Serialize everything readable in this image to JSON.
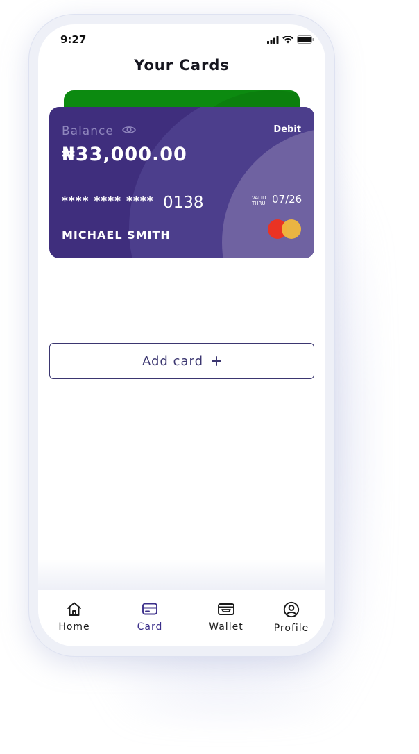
{
  "status_bar": {
    "time": "9:27"
  },
  "header": {
    "title": "Your Cards"
  },
  "cards": {
    "back_card_color": "#0c8a10",
    "primary": {
      "balance_label": "Balance",
      "type": "Debit",
      "balance": "₦33,000.00",
      "number_masked": "**** **** ****",
      "number_last4": "0138",
      "valid_thru_label": "VALID THRU",
      "expiry": "07/26",
      "holder": "MICHAEL SMITH",
      "network_icon": "mastercard-logo",
      "color": "#3f2e7d"
    }
  },
  "actions": {
    "add_card_label": "Add card",
    "add_card_icon": "plus-icon"
  },
  "bottom_nav": {
    "items": [
      {
        "label": "Home",
        "icon": "home-icon",
        "active": false
      },
      {
        "label": "Card",
        "icon": "card-icon",
        "active": true
      },
      {
        "label": "Wallet",
        "icon": "wallet-icon",
        "active": false
      },
      {
        "label": "Profile",
        "icon": "profile-icon",
        "active": false
      }
    ],
    "active_color": "#3b2f8a"
  }
}
